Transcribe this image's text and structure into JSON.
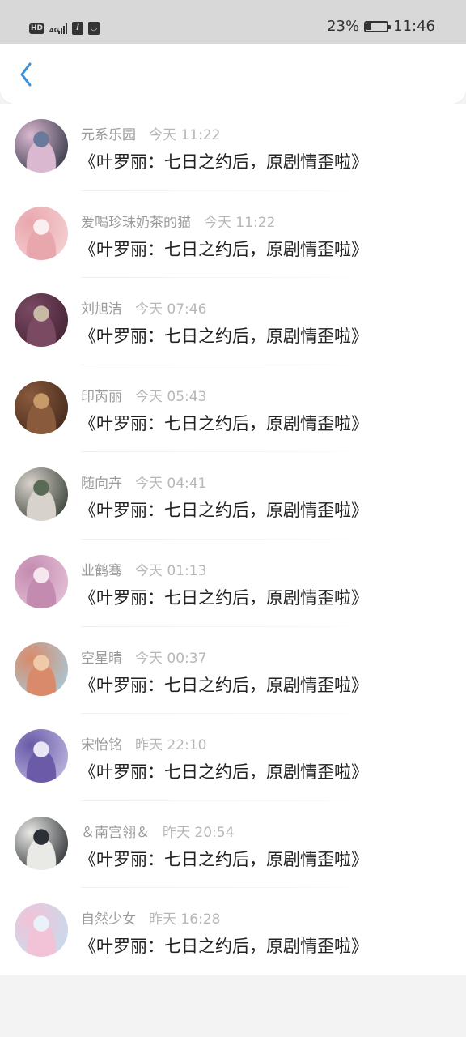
{
  "status_bar": {
    "hd": "HD",
    "network": "4G",
    "battery_pct": "23%",
    "battery_level": 0.23,
    "time": "11:46"
  },
  "header": {
    "back_icon": "chevron-left-icon",
    "accent": "#3a8fd9"
  },
  "messages": [
    {
      "name": "元系乐园",
      "time": "今天 11:22",
      "title": "《叶罗丽：七日之约后，原剧情歪啦》",
      "avatar_colors": [
        "#1b2233",
        "#d9b8d0",
        "#6b7a9a"
      ]
    },
    {
      "name": "爱喝珍珠奶茶的猫",
      "time": "今天 11:22",
      "title": "《叶罗丽：七日之约后，原剧情歪啦》",
      "avatar_colors": [
        "#f7d7d8",
        "#e8a7ad",
        "#fbeef0"
      ]
    },
    {
      "name": "刘旭洁",
      "time": "今天 07:46",
      "title": "《叶罗丽：七日之约后，原剧情歪啦》",
      "avatar_colors": [
        "#3c1d2d",
        "#7a4a63",
        "#c8b8a6"
      ]
    },
    {
      "name": "印芮丽",
      "time": "今天 05:43",
      "title": "《叶罗丽：七日之约后，原剧情歪啦》",
      "avatar_colors": [
        "#3a2218",
        "#8a5a3c",
        "#c89a6a"
      ]
    },
    {
      "name": "随向卉",
      "time": "今天 04:41",
      "title": "《叶罗丽：七日之约后，原剧情歪啦》",
      "avatar_colors": [
        "#1f2a1f",
        "#d8d2cc",
        "#5a6a55"
      ]
    },
    {
      "name": "业鹤骞",
      "time": "今天 01:13",
      "title": "《叶罗丽：七日之约后，原剧情歪啦》",
      "avatar_colors": [
        "#e9c9dc",
        "#c48bb0",
        "#f6e7ef"
      ]
    },
    {
      "name": "空星晴",
      "time": "今天 00:37",
      "title": "《叶罗丽：七日之约后，原剧情歪啦》",
      "avatar_colors": [
        "#9fd3e6",
        "#d98a6a",
        "#f0c9a8"
      ]
    },
    {
      "name": "宋怡铭",
      "time": "昨天 22:10",
      "title": "《叶罗丽：七日之约后，原剧情歪啦》",
      "avatar_colors": [
        "#c9c4e6",
        "#6a5aa8",
        "#e8e6f5"
      ]
    },
    {
      "name": "＆南宫翎＆",
      "time": "昨天 20:54",
      "title": "《叶罗丽：七日之约后，原剧情歪啦》",
      "avatar_colors": [
        "#101418",
        "#e9e9e6",
        "#2a3036"
      ]
    },
    {
      "name": "自然少女",
      "time": "昨天 16:28",
      "title": "《叶罗丽：七日之约后，原剧情歪啦》",
      "avatar_colors": [
        "#bfe0f2",
        "#f2c2d6",
        "#e9f2f8"
      ]
    }
  ]
}
